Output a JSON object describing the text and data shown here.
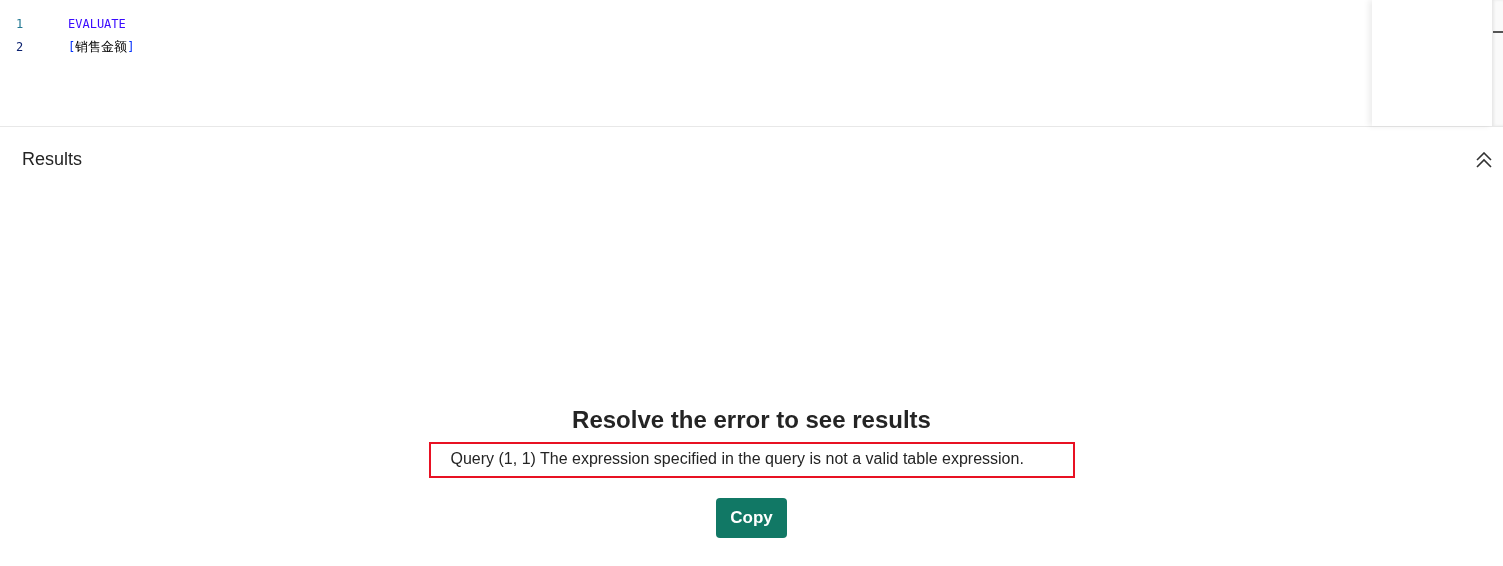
{
  "editor": {
    "lines": [
      {
        "number": "1",
        "tokens": [
          {
            "kind": "keyword",
            "text": "EVALUATE"
          }
        ]
      },
      {
        "number": "2",
        "tokens": [
          {
            "kind": "bracket",
            "text": "["
          },
          {
            "kind": "plain",
            "text": "销售金额"
          },
          {
            "kind": "bracket",
            "text": "]"
          }
        ]
      }
    ]
  },
  "results": {
    "title": "Results",
    "expanded": true,
    "error_title": "Resolve the error to see results",
    "error_message": "Query (1, 1) The expression specified in the query is not a valid table expression.",
    "copy_button": "Copy"
  }
}
